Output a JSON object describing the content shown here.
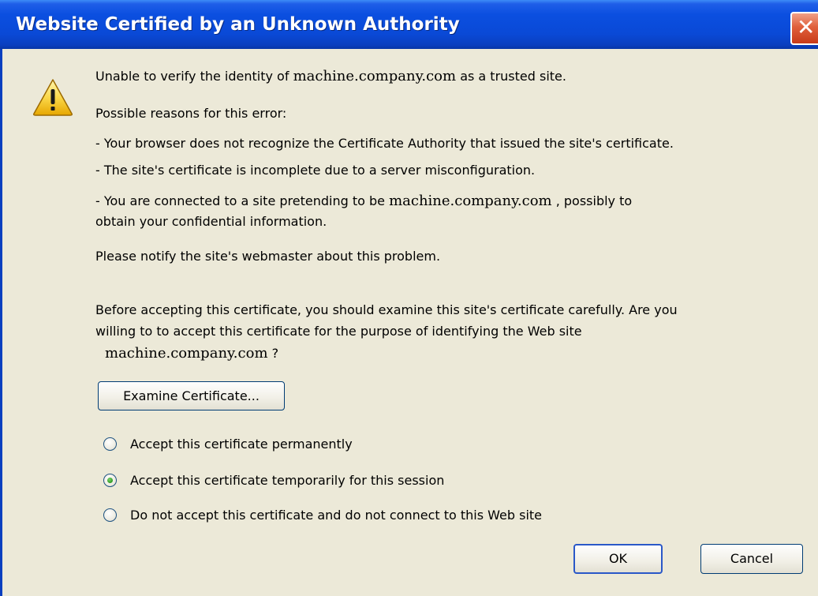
{
  "dialog": {
    "title": "Website Certified by an Unknown Authority",
    "close_glyph": "✕"
  },
  "message": {
    "line1_before": "Unable to verify the identity of ",
    "site": "machine.company.com",
    "line1_after": " as a trusted site.",
    "reasons_heading": "Possible reasons for this error:",
    "reason1": "- Your browser does not recognize the Certificate Authority that issued the site's certificate.",
    "reason2": "- The site's certificate is incomplete due to a server misconfiguration.",
    "reason3_before": "- You are connected to a site pretending to be ",
    "reason3_after": " , possibly to",
    "reason3_line2": "obtain your confidential information.",
    "notify": "Please notify the site's webmaster about this problem.",
    "question_line1": "Before accepting this certificate, you should examine this site's certificate carefully. Are you",
    "question_line2": "willing to to accept this certificate for the purpose of identifying the Web site",
    "question_end": " ?"
  },
  "buttons": {
    "examine": "Examine Certificate...",
    "ok": "OK",
    "cancel": "Cancel"
  },
  "options": [
    {
      "label": "Accept this certificate permanently",
      "checked": false
    },
    {
      "label": "Accept this certificate temporarily for this session",
      "checked": true
    },
    {
      "label": "Do not accept this certificate and do not connect to this Web site",
      "checked": false
    }
  ],
  "icons": {
    "warning": "warning-icon",
    "close": "close-icon"
  },
  "colors": {
    "titlebar": "#0a49d6",
    "dialog_bg": "#ece9d8",
    "close_button": "#e0603c",
    "radio_selected": "#2d9a22"
  }
}
